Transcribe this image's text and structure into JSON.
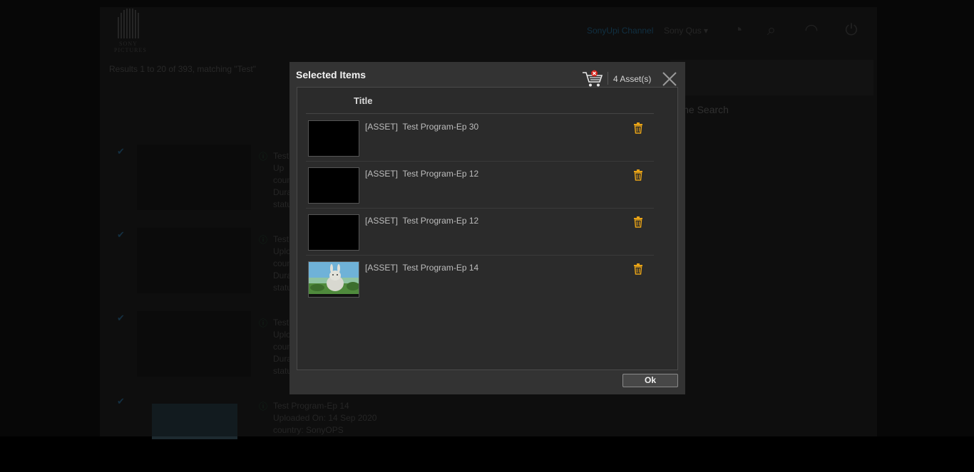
{
  "background": {
    "brand": "SONY PICTURES",
    "channel_link": "SonyUpi Channel",
    "user_menu": "Sony Qus",
    "results_text": "Results 1 to 20 of 393, matching \"Test\"",
    "refine_label": "ine Search",
    "rows": [
      {
        "title": "Test",
        "lines": [
          "Up",
          "coun",
          "Durat",
          "statu"
        ]
      },
      {
        "title": "Test",
        "lines": [
          "Uplo",
          "coun",
          "Dura",
          "statu"
        ]
      },
      {
        "title": "Test",
        "lines": [
          "Uplo",
          "coun",
          "Dura",
          "statu"
        ]
      },
      {
        "title": "Test Program-Ep 14",
        "lines": [
          "Uploaded On: 14 Sep 2020",
          "country: SonyOPS"
        ]
      }
    ]
  },
  "modal": {
    "title": "Selected Items",
    "asset_count": "4 Asset(s)",
    "column_title": "Title",
    "items": [
      {
        "label": "[ASSET]  Test Program-Ep 30",
        "thumb": "black"
      },
      {
        "label": "[ASSET]  Test Program-Ep 12",
        "thumb": "black"
      },
      {
        "label": "[ASSET]  Test Program-Ep 12",
        "thumb": "black"
      },
      {
        "label": "[ASSET]  Test Program-Ep 14",
        "thumb": "bunny-scene"
      }
    ],
    "ok_label": "Ok"
  },
  "icons": {
    "cart": "cart-remove-icon",
    "close": "close-icon",
    "delete": "trash-icon"
  },
  "colors": {
    "trash": "#e8a317",
    "cart_badge": "#d9261c",
    "modal_bg": "#333333",
    "channel_link": "#1a4a66"
  }
}
